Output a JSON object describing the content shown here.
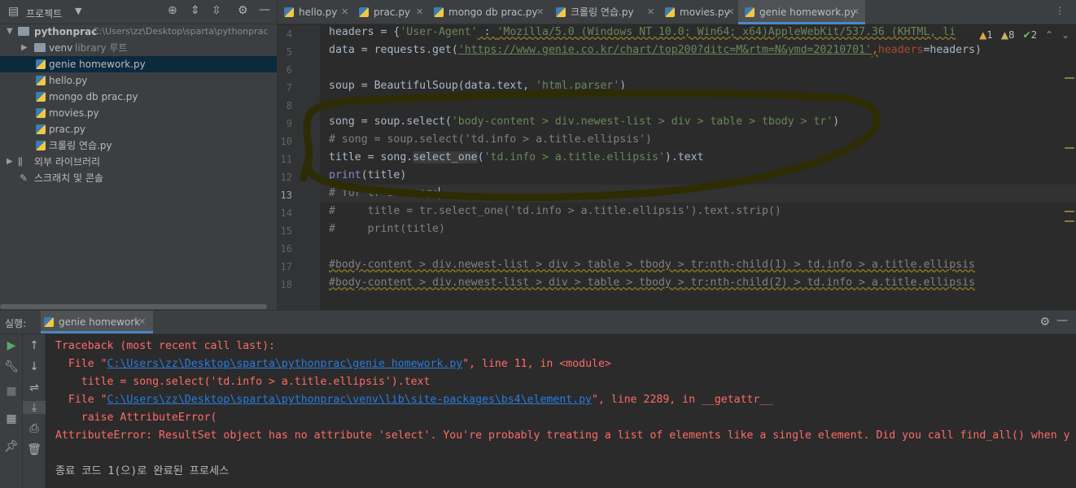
{
  "project": {
    "title": "프로젝트",
    "root_name": "pythonprac",
    "root_path": "C:\\Users\\zz\\Desktop\\sparta\\pythonprac",
    "venv_name": "venv",
    "venv_hint": "library 루트",
    "files": [
      "genie homework.py",
      "hello.py",
      "mongo db prac.py",
      "movies.py",
      "prac.py",
      "크롤링 연습.py"
    ],
    "external_libs": "외부 라이브러리",
    "scratches": "스크래치 및 콘솔"
  },
  "tabs": [
    "hello.py",
    "prac.py",
    "mongo db prac.py",
    "크롤링 연습.py",
    "movies.py",
    "genie homework.py"
  ],
  "active_tab": "genie homework.py",
  "inspections": {
    "warnings": "1",
    "weak_warnings": "8",
    "typos": "2"
  },
  "editor": {
    "line_numbers": [
      "4",
      "5",
      "6",
      "7",
      "8",
      "9",
      "10",
      "11",
      "12",
      "13",
      "14",
      "15",
      "16",
      "17",
      "18"
    ],
    "lines": {
      "l4": {
        "a": "headers = {",
        "b": "'User-Agent'",
        "c": " : ",
        "d": "'Mozilla/5.0 (Windows NT 10.0; Win64; x64)AppleWebKit/537.36 (KHTML, li"
      },
      "l5": {
        "a": "data = requests.get(",
        "b": "'https://www.genie.co.kr/chart/top200?ditc=M&rtm=N&ymd=20210701'",
        "c": ",",
        "d": "headers",
        "e": "=headers)"
      },
      "l7": {
        "a": "soup = BeautifulSoup(data.text, ",
        "b": "'html.parser'",
        "c": ")"
      },
      "l9": {
        "a": "song = soup.select(",
        "b": "'body-content > div.newest-list > div > table > tbody > tr'",
        "c": ")"
      },
      "l10": "# song = soup.select('td.info > a.title.ellipsis')",
      "l11": {
        "a": "title = song.",
        "b": "select_one",
        "c": "(",
        "d": "'td.info > a.title.ellipsis'",
        "e": ").text"
      },
      "l12": {
        "a": "print",
        "b": "(title)"
      },
      "l13": "# for tr in song:",
      "l14": "#     title = tr.select_one('td.info > a.title.ellipsis').text.strip()",
      "l15": "#     print(title)",
      "l17": "#body-content > div.newest-list > div > table > tbody > tr:nth-child(1) > td.info > a.title.ellipsis",
      "l18": "#body-content > div.newest-list > div > table > tbody > tr:nth-child(2) > td.info > a.title.ellipsis"
    }
  },
  "run": {
    "label": "실행:",
    "tab": "genie homework",
    "traceback": "Traceback (most recent call last):",
    "file1_prefix": "  File \"",
    "file1_path": "C:\\Users\\zz\\Desktop\\sparta\\pythonprac\\genie homework.py",
    "file1_suffix": "\", line 11, in <module>",
    "code1": "    title = song.select('td.info > a.title.ellipsis').text",
    "file2_prefix": "  File \"",
    "file2_path": "C:\\Users\\zz\\Desktop\\sparta\\pythonprac\\venv\\lib\\site-packages\\bs4\\element.py",
    "file2_suffix": "\", line 2289, in __getattr__",
    "code2": "    raise AttributeError(",
    "error": "AttributeError: ResultSet object has no attribute 'select'. You're probably treating a list of elements like a single element. Did you call find_all() when y",
    "exit": "종료 코드 1(으)로 완료된 프로세스"
  },
  "colors": {
    "accent": "#4a88c7",
    "highlight": "#2d2a05",
    "error": "#ff6b68"
  }
}
